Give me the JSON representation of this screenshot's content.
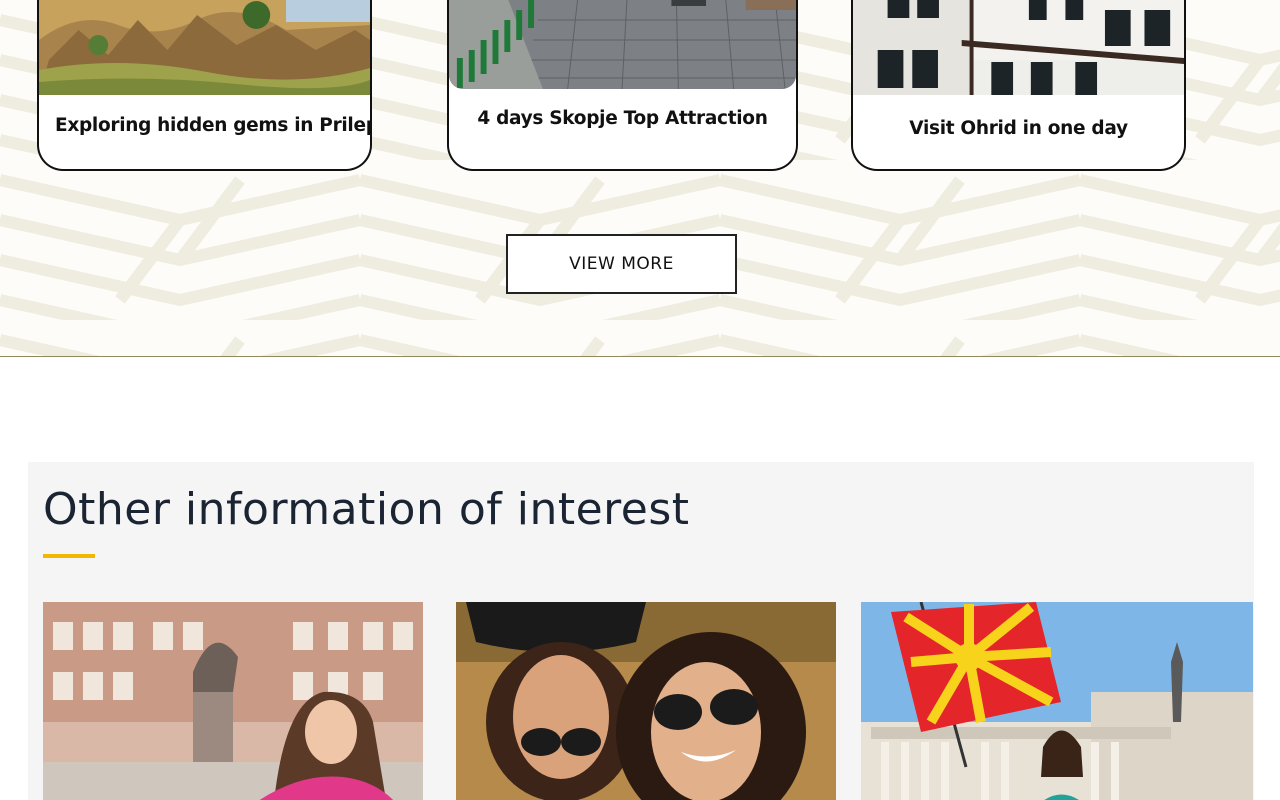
{
  "tours": {
    "cards": [
      {
        "title": "Exploring hidden gems in Prilep"
      },
      {
        "title": "4 days Skopje Top Attraction"
      },
      {
        "title": "Visit Ohrid in one day"
      }
    ],
    "view_more_label": "VIEW MORE"
  },
  "other_info": {
    "heading": "Other information of interest",
    "accent_color": "#f2b705"
  },
  "colors": {
    "card_border": "#111111",
    "section_bg": "#fdfcf8",
    "info_bg": "#f5f5f5"
  }
}
